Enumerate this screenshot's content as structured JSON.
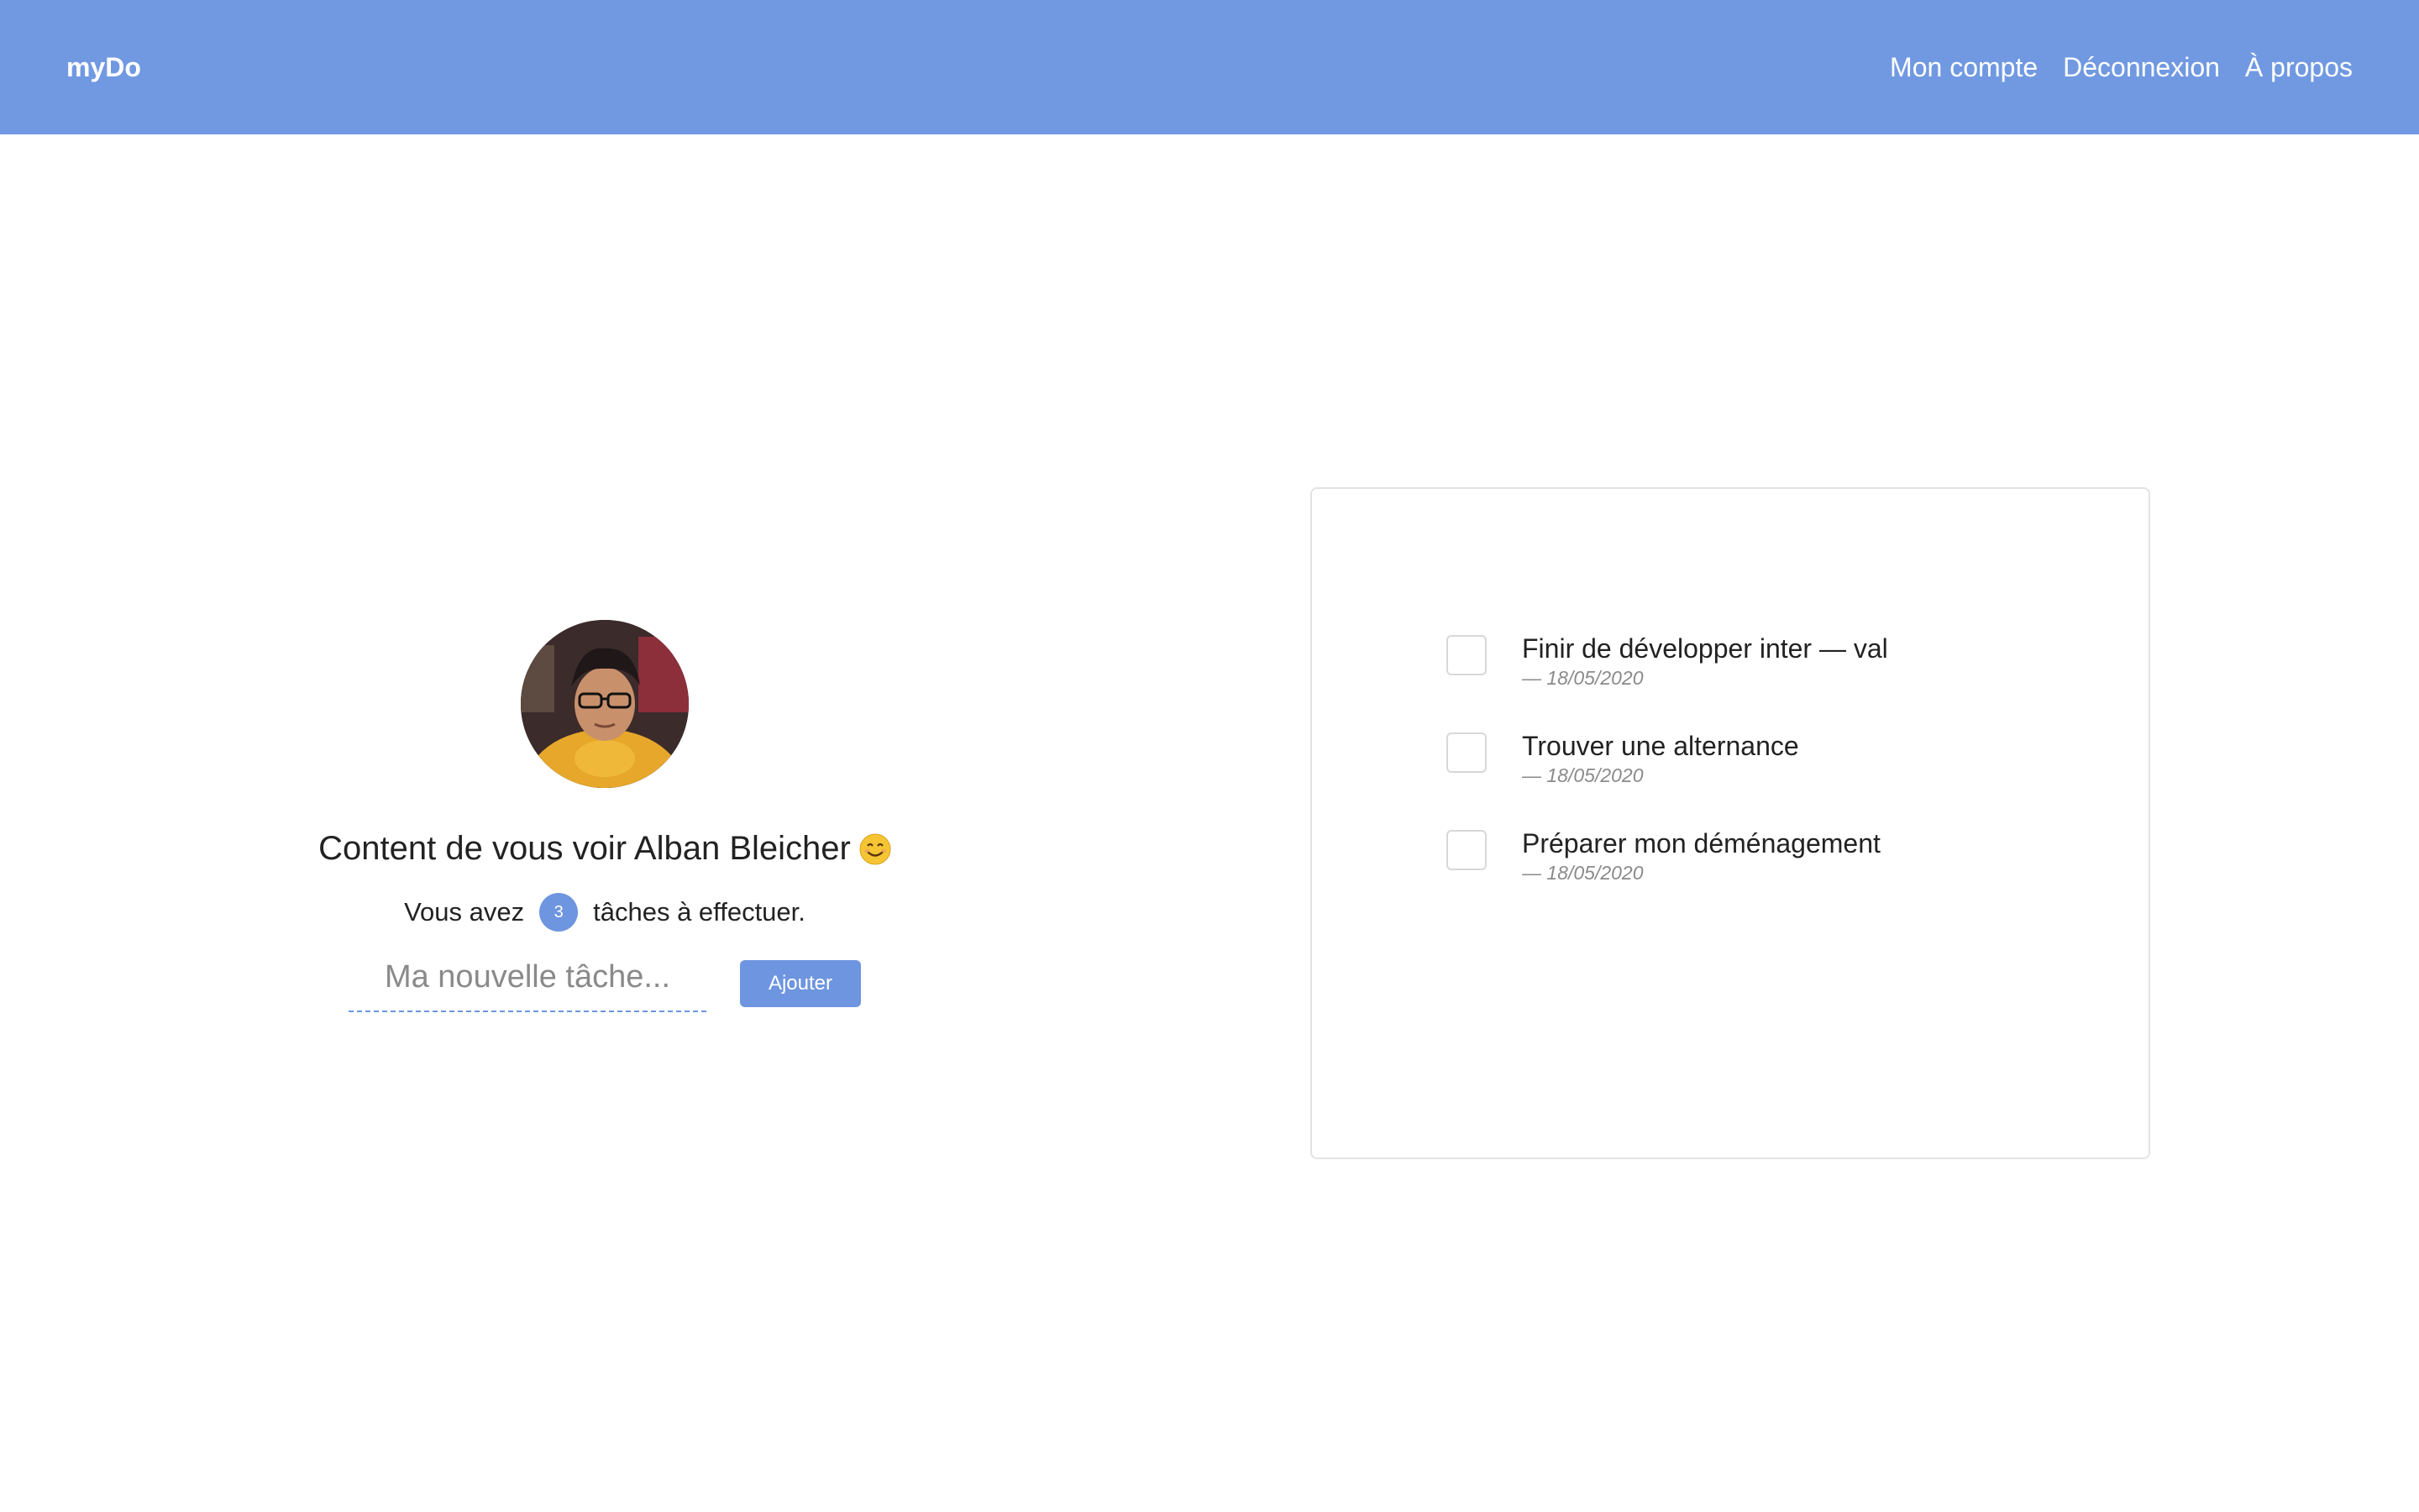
{
  "navbar": {
    "brand": "myDo",
    "links": [
      "Mon compte",
      "Déconnexion",
      "À propos"
    ]
  },
  "welcome": {
    "greeting": "Content de vous voir Alban Bleicher",
    "emoji_icon": "smiling-face-icon",
    "tasks_prefix": "Vous avez",
    "task_count": "3",
    "tasks_suffix": "tâches à effectuer."
  },
  "add_form": {
    "placeholder": "Ma nouvelle tâche...",
    "value": "",
    "button_label": "Ajouter"
  },
  "todos": [
    {
      "title": "Finir de développer inter — val",
      "date": "— 18/05/2020",
      "done": false
    },
    {
      "title": "Trouver une alternance",
      "date": "— 18/05/2020",
      "done": false
    },
    {
      "title": "Préparer mon déménagement",
      "date": "— 18/05/2020",
      "done": false
    }
  ],
  "colors": {
    "accent": "#7199e2",
    "badge": "#6e95df",
    "border": "#e3e3e3"
  }
}
